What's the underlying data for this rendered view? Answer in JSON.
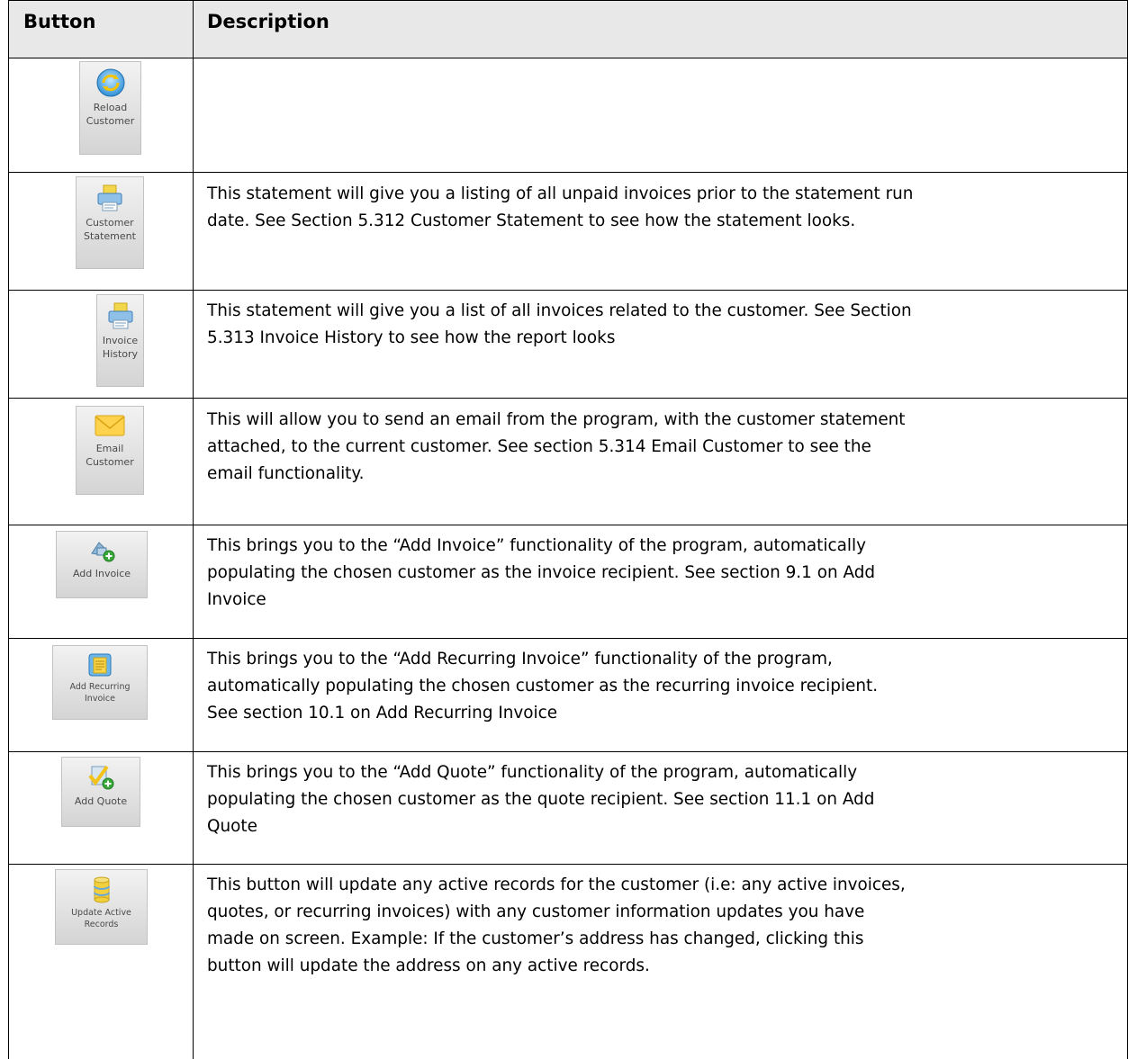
{
  "table": {
    "headers": {
      "button": "Button",
      "description": "Description"
    },
    "rows": [
      {
        "button_label": "Reload\nCustomer",
        "icon": "reload-icon",
        "description": ""
      },
      {
        "button_label": "Customer\nStatement",
        "icon": "printer-icon",
        "description": "This statement will give you a listing of all unpaid invoices prior to the statement run\ndate.  See Section 5.312 Customer Statement to see how the statement looks."
      },
      {
        "button_label": "Invoice\nHistory",
        "icon": "printer-icon",
        "description": "This statement will give you a list of all invoices related to the customer.  See Section\n5.313 Invoice History to see how the report looks"
      },
      {
        "button_label": "Email\nCustomer",
        "icon": "envelope-icon",
        "description": "This will allow you to send an email from the program, with the customer statement\nattached, to the current customer.  See section 5.314 Email Customer to see the\nemail functionality."
      },
      {
        "button_label": "Add Invoice",
        "icon": "add-invoice-icon",
        "description": "This brings you to the “Add Invoice” functionality of the program, automatically\npopulating the chosen customer as the invoice recipient.  See section 9.1 on Add\nInvoice"
      },
      {
        "button_label": "Add Recurring\nInvoice",
        "icon": "recurring-invoice-icon",
        "description": "This brings you to the “Add Recurring Invoice” functionality of the program,\nautomatically populating the chosen customer as the recurring invoice recipient.\nSee section 10.1 on Add Recurring Invoice"
      },
      {
        "button_label": "Add Quote",
        "icon": "add-quote-icon",
        "description": "This brings you to the “Add Quote” functionality of the program, automatically\npopulating the chosen customer as the quote recipient.  See section 11.1 on Add\nQuote"
      },
      {
        "button_label": "Update Active\nRecords",
        "icon": "database-icon",
        "description": "This button will update any active records for the customer (i.e: any active invoices,\nquotes, or recurring invoices) with any customer information updates you have\nmade on screen.  Example: If the customer’s address has changed, clicking this\nbutton will update the address on any active records."
      }
    ]
  }
}
